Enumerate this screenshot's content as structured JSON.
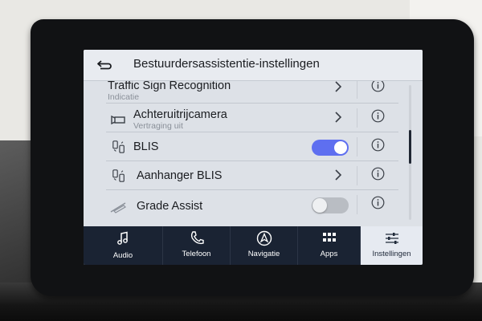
{
  "header": {
    "title": "Bestuurdersassistentie-instellingen"
  },
  "rows": [
    {
      "label": "Traffic Sign Recognition",
      "subtitle": "Indicatie"
    },
    {
      "label": "Achteruitrijcamera",
      "subtitle": "Vertraging uit"
    },
    {
      "label": "BLIS",
      "toggle": "on"
    },
    {
      "label": "Aanhanger BLIS"
    },
    {
      "label": "Grade Assist",
      "toggle": "off"
    }
  ],
  "nav": [
    {
      "label": "Audio",
      "icon": "music-note-icon"
    },
    {
      "label": "Telefoon",
      "icon": "phone-icon"
    },
    {
      "label": "Navigatie",
      "icon": "navigation-icon"
    },
    {
      "label": "Apps",
      "icon": "apps-grid-icon"
    },
    {
      "label": "Instellingen",
      "icon": "settings-sliders-icon",
      "active": true
    }
  ],
  "colors": {
    "toggle_on": "#5e6ff0",
    "nav_background": "#1a2333",
    "active_tab_background": "#e6eaf1"
  }
}
